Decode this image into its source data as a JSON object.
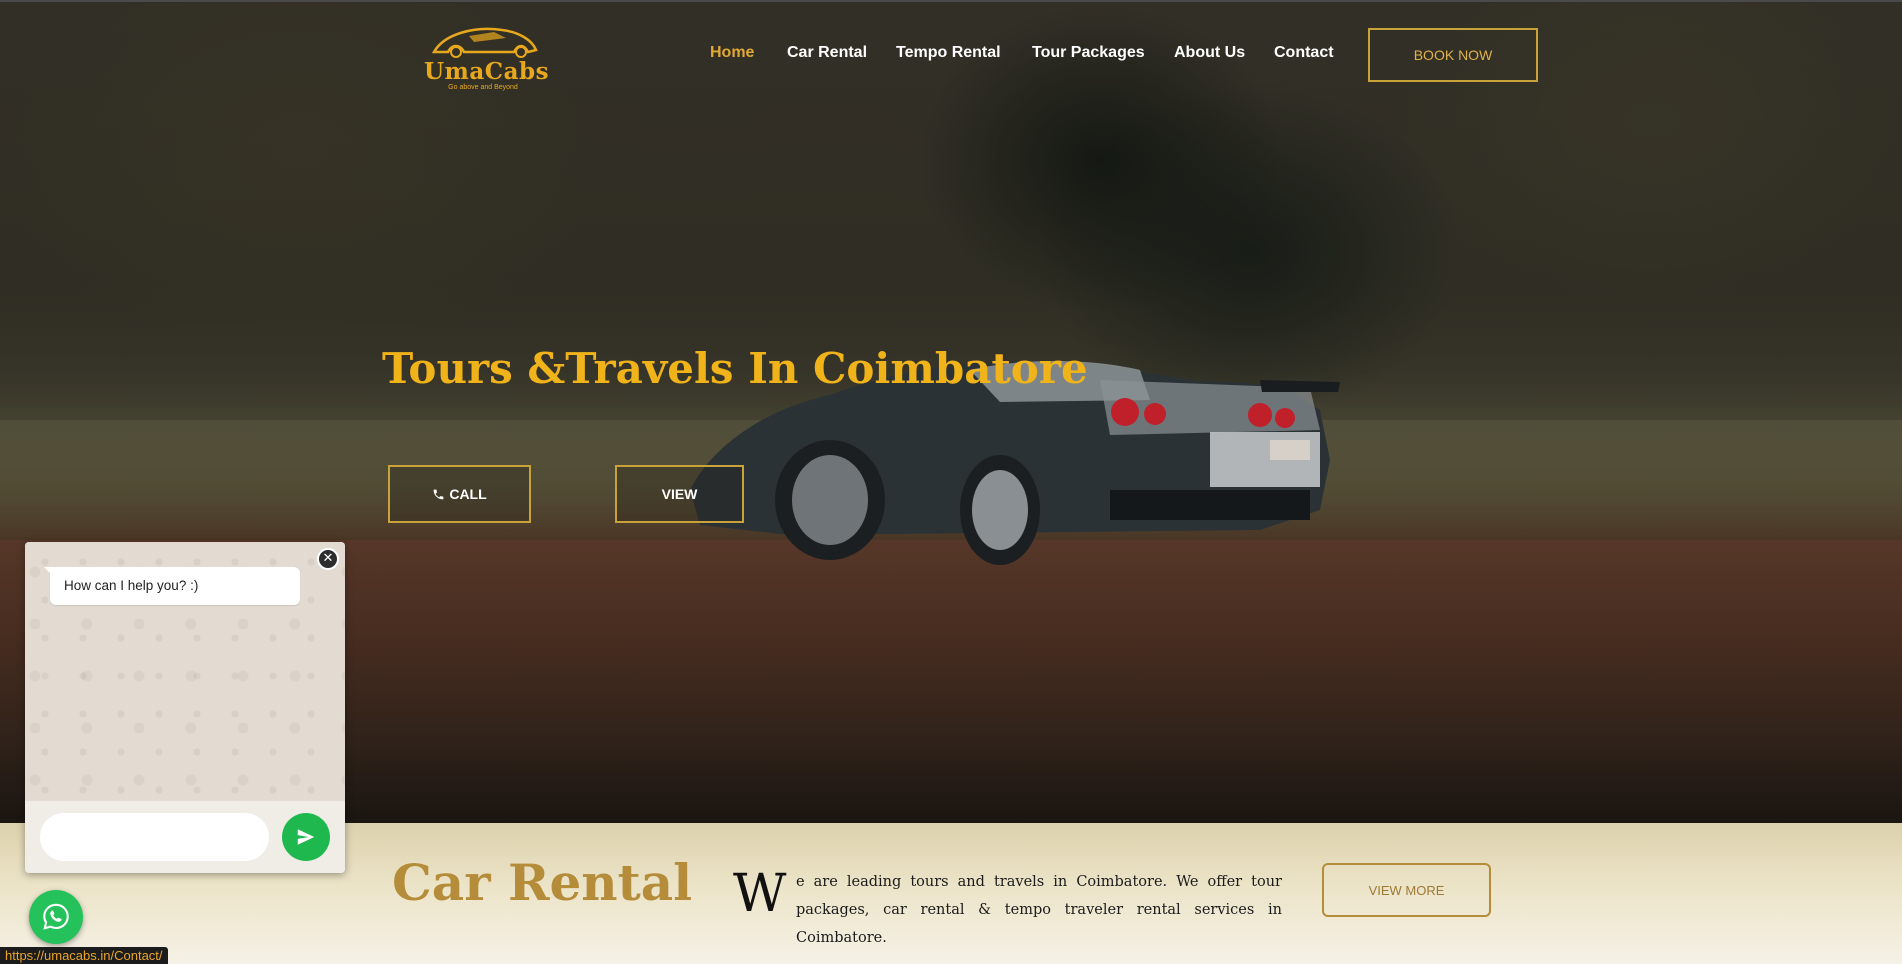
{
  "header": {
    "logo": {
      "name": "UmaCabs",
      "tagline": "Go above and Beyond"
    },
    "nav": [
      {
        "label": "Home",
        "active": true
      },
      {
        "label": "Car Rental",
        "active": false
      },
      {
        "label": "Tempo Rental",
        "active": false
      },
      {
        "label": "Tour Packages",
        "active": false
      },
      {
        "label": "About Us",
        "active": false
      },
      {
        "label": "Contact",
        "active": false
      }
    ],
    "book_button": "BOOK NOW"
  },
  "hero": {
    "title": "Tours &Travels In Coimbatore",
    "call_button": "CALL",
    "view_button": "VIEW"
  },
  "section": {
    "title": "Car Rental",
    "dropcap": "W",
    "text": "e are leading tours and travels in Coimbatore. We offer tour packages, car rental & tempo traveler rental services in Coimbatore.",
    "view_more_button": "VIEW MORE"
  },
  "chat": {
    "message": "How can I help you? :)",
    "input_placeholder": "",
    "icons": {
      "close": "close-icon",
      "send": "send-icon",
      "whatsapp": "whatsapp-icon"
    }
  },
  "status_bar": {
    "url": "https://umacabs.in/Contact/"
  },
  "colors": {
    "accent": "#e0a837",
    "gold": "#b58d3a",
    "whatsapp": "#25c15b"
  }
}
